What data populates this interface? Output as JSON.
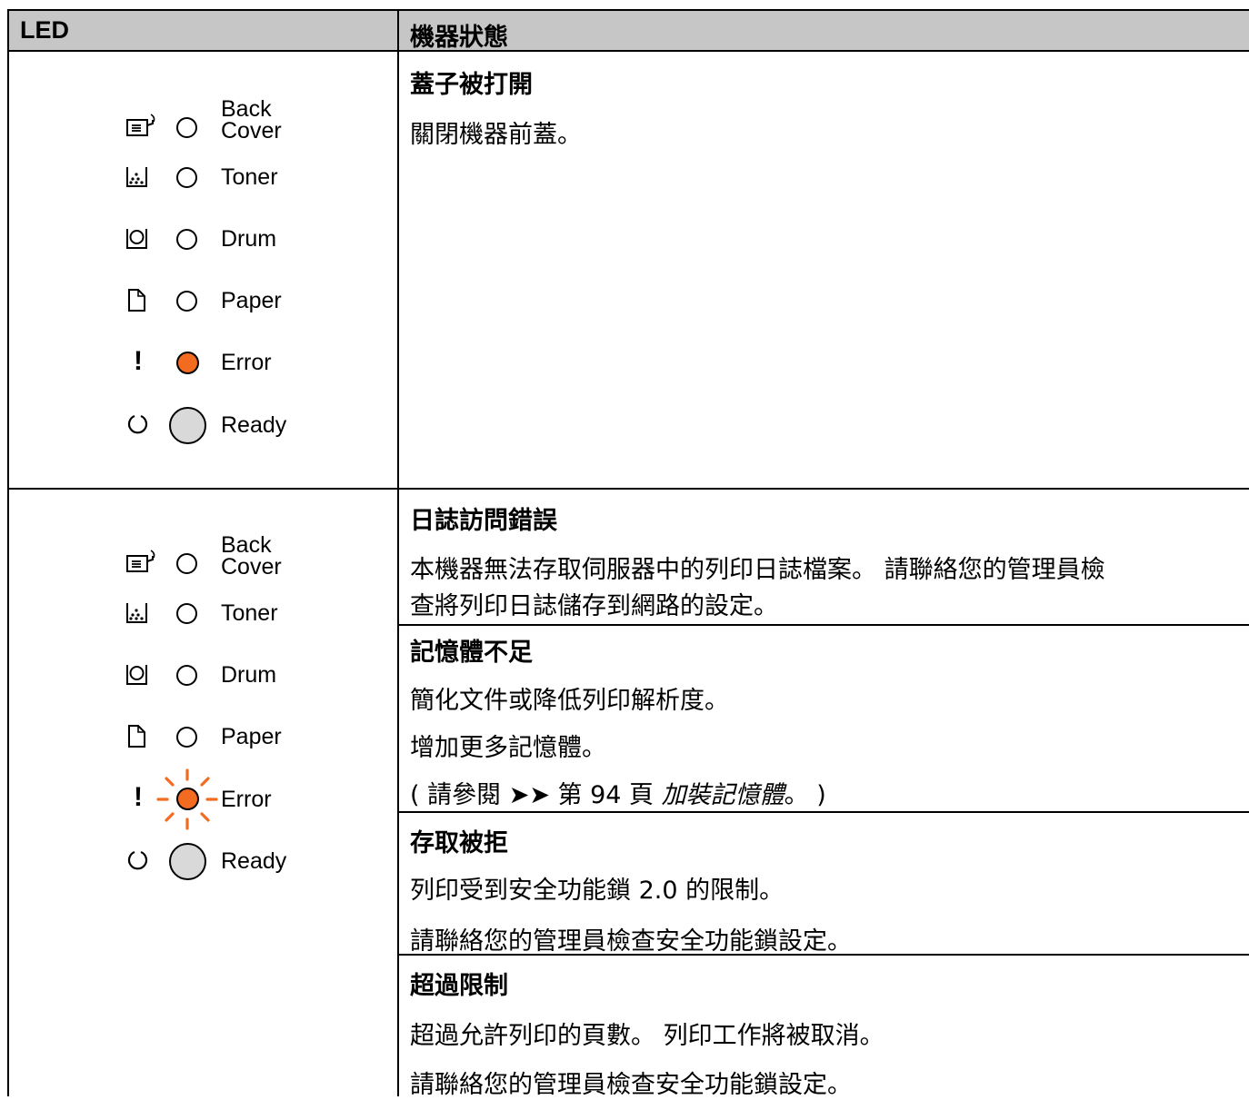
{
  "header": {
    "col1": "LED",
    "col2": "機器狀態"
  },
  "led_labels": {
    "back_line1": "Back",
    "back_line2": "Cover",
    "toner": "Toner",
    "drum": "Drum",
    "paper": "Paper",
    "error": "Error",
    "ready": "Ready",
    "exclaim": "!"
  },
  "led_colors": {
    "error": "#f26b21",
    "off_outline": "#000000",
    "ready_fill": "#d9d9d9"
  },
  "led_states": [
    {
      "error": "on",
      "others": "off"
    },
    {
      "error": "blinking",
      "others": "off"
    }
  ],
  "status": {
    "cover_open": {
      "title": "蓋子被打開",
      "line1": "關閉機器前蓋。"
    },
    "log_error": {
      "title": "日誌訪問錯誤",
      "line1": "本機器無法存取伺服器中的列印日誌檔案。 請聯絡您的管理員檢",
      "line2": "查將列印日誌儲存到網路的設定。"
    },
    "memory": {
      "title": "記憶體不足",
      "line1": "簡化文件或降低列印解析度。",
      "line2": "增加更多記憶體。",
      "ref_prefix": "( 請參閱 ➤➤ 第 94 頁 ",
      "ref_link": "加裝記憶體",
      "ref_suffix": "。 )"
    },
    "access_denied": {
      "title": "存取被拒",
      "line1": "列印受到安全功能鎖 2.0 的限制。",
      "line2": "請聯絡您的管理員檢查安全功能鎖設定。"
    },
    "limit_exceeded": {
      "title": "超過限制",
      "line1": "超過允許列印的頁數。 列印工作將被取消。",
      "line2": "請聯絡您的管理員檢查安全功能鎖設定。"
    }
  }
}
